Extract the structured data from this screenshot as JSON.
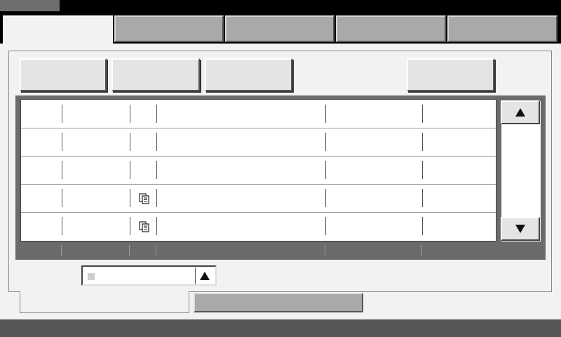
{
  "window": {
    "title": ""
  },
  "tabs": [
    {
      "label": ""
    },
    {
      "label": ""
    },
    {
      "label": ""
    },
    {
      "label": ""
    },
    {
      "label": ""
    }
  ],
  "toolbar": {
    "buttons": [
      {
        "label": ""
      },
      {
        "label": ""
      },
      {
        "label": ""
      },
      {
        "label": ""
      }
    ]
  },
  "table": {
    "columns": [
      "",
      "",
      "",
      "",
      "",
      ""
    ],
    "rows": [
      {
        "cells": [
          "",
          "",
          "",
          "",
          "",
          ""
        ],
        "icon": ""
      },
      {
        "cells": [
          "",
          "",
          "",
          "",
          "",
          ""
        ],
        "icon": ""
      },
      {
        "cells": [
          "",
          "",
          "",
          "",
          "",
          ""
        ],
        "icon": ""
      },
      {
        "cells": [
          "",
          "",
          "",
          "",
          "",
          ""
        ],
        "icon": "copy-icon"
      },
      {
        "cells": [
          "",
          "",
          "",
          "",
          "",
          ""
        ],
        "icon": "copy-icon"
      }
    ]
  },
  "scrollbar": {
    "up_icon": "triangle-up-icon",
    "down_icon": "triangle-down-icon"
  },
  "dropdown": {
    "value": "",
    "button_icon": "triangle-up-icon"
  },
  "bottom_tabs": [
    {
      "label": ""
    },
    {
      "label": ""
    }
  ],
  "status": {
    "text": ""
  },
  "colors": {
    "dark": "#000000",
    "panel": "#f2f2f2",
    "tab": "#a9a9a9",
    "table_frame": "#6b6b6b"
  }
}
